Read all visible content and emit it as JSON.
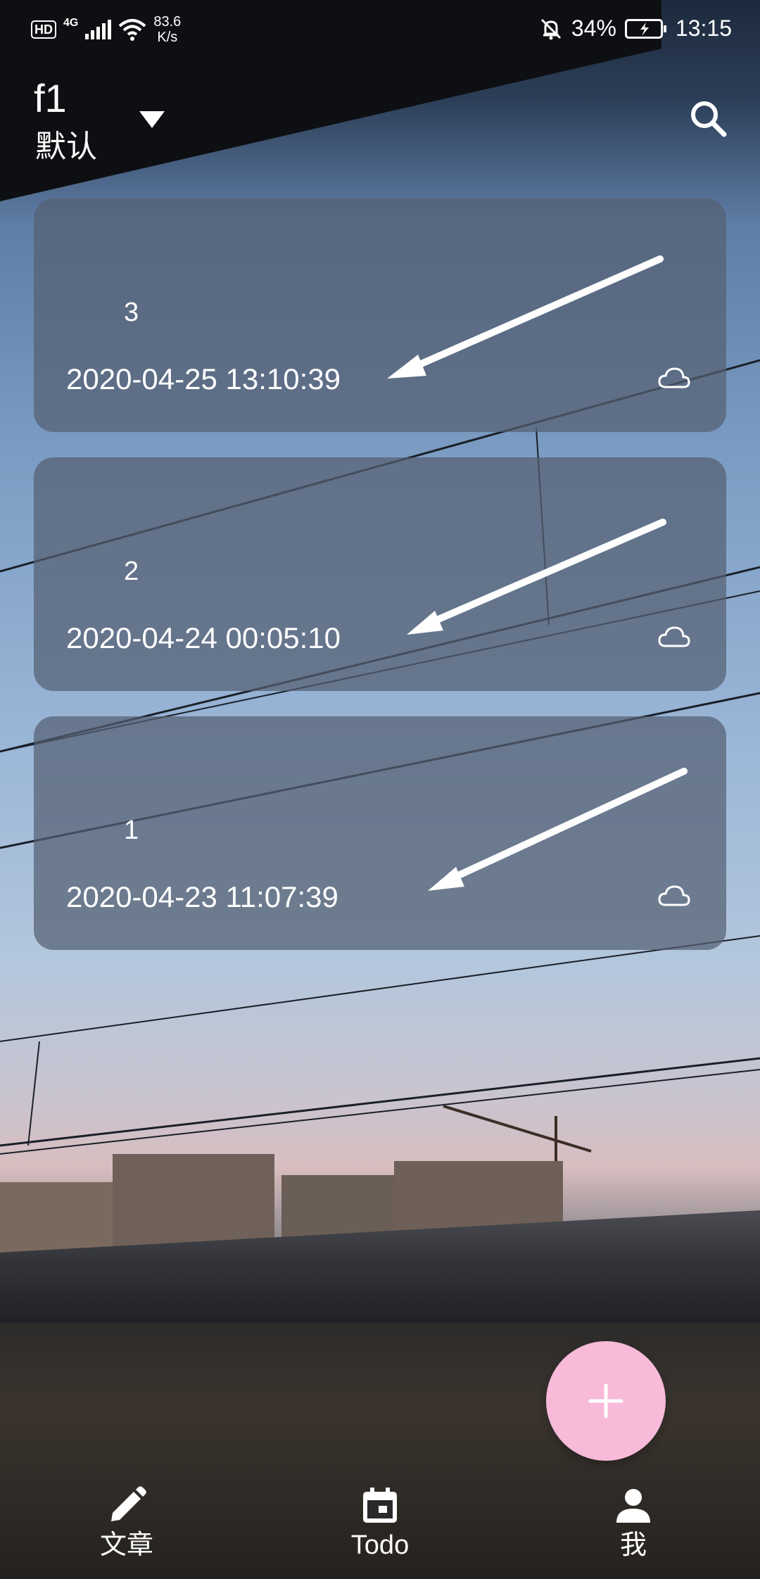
{
  "status_bar": {
    "hd_badge": "HD",
    "network_type": "4G",
    "net_speed_value": "83.6",
    "net_speed_unit": "K/s",
    "battery_percent": "34%",
    "time": "13:15"
  },
  "app_bar": {
    "folder_name": "f1",
    "folder_subtitle": "默认",
    "icons": [
      "dropdown-icon",
      "search-icon"
    ]
  },
  "notes": [
    {
      "title": "3",
      "date": "2020-04-25 13:10:39",
      "icon": "cloud-icon"
    },
    {
      "title": "2",
      "date": "2020-04-24 00:05:10",
      "icon": "cloud-icon"
    },
    {
      "title": "1",
      "date": "2020-04-23 11:07:39",
      "icon": "cloud-icon"
    }
  ],
  "fab": {
    "icon": "plus-icon",
    "color": "#f7bad9"
  },
  "bottom_nav": {
    "items": [
      {
        "label": "文章",
        "icon": "pencil-icon"
      },
      {
        "label": "Todo",
        "icon": "calendar-icon"
      },
      {
        "label": "我",
        "icon": "person-icon"
      }
    ]
  }
}
